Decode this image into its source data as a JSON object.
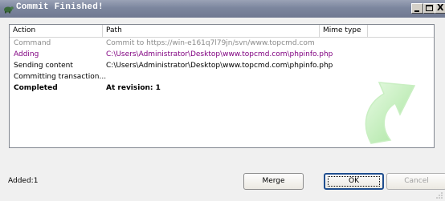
{
  "window": {
    "title": "Commit Finished!",
    "controls": {
      "minimize": "_",
      "maximize": "□",
      "close": "X"
    }
  },
  "list": {
    "columns": [
      "Action",
      "Path",
      "Mime type"
    ],
    "rows": [
      {
        "action": "Command",
        "path": "Commit to https://win-e161q7l79jn/svn/www.topcmd.com",
        "style": "gray"
      },
      {
        "action": "Adding",
        "path": "C:\\Users\\Administrator\\Desktop\\www.topcmd.com\\phpinfo.php",
        "style": "purple"
      },
      {
        "action": "Sending content",
        "path": "C:\\Users\\Administrator\\Desktop\\www.topcmd.com\\phpinfo.php",
        "style": "black"
      },
      {
        "action": "Committing transaction...",
        "path": "",
        "style": "black"
      },
      {
        "action": "Completed",
        "path": "At revision: 1",
        "style": "bold"
      }
    ],
    "decoration_icon": "green-curved-arrow-icon"
  },
  "status": {
    "text": "Added:1"
  },
  "buttons": {
    "merge": "Merge",
    "ok": "OK",
    "cancel": "Cancel"
  },
  "colors": {
    "titlebar": "#7c869e",
    "added": "#800080",
    "gray_text": "#8a8a8a",
    "arrow": "#b8ebb0"
  }
}
